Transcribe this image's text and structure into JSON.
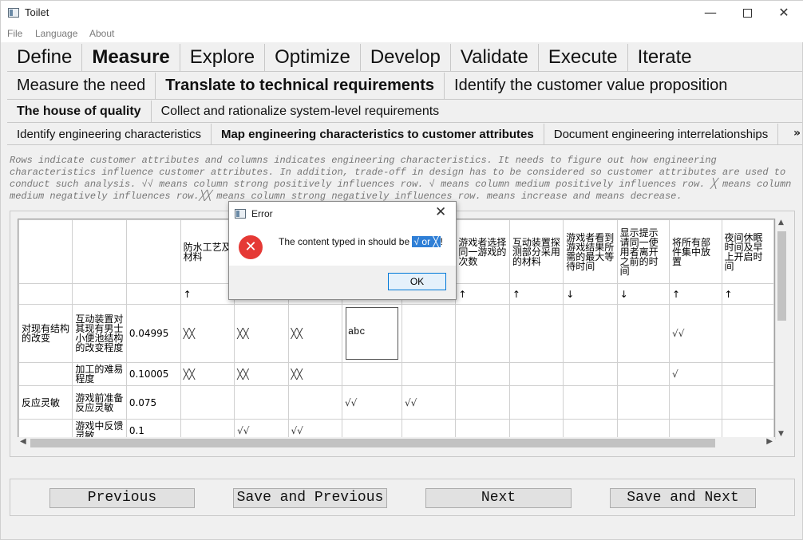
{
  "window": {
    "title": "Toilet",
    "minimize": "—",
    "close": "✕"
  },
  "menu": [
    "File",
    "Language",
    "About"
  ],
  "tabs_level1": [
    {
      "label": "Define",
      "active": false
    },
    {
      "label": "Measure",
      "active": true
    },
    {
      "label": "Explore",
      "active": false
    },
    {
      "label": "Optimize",
      "active": false
    },
    {
      "label": "Develop",
      "active": false
    },
    {
      "label": "Validate",
      "active": false
    },
    {
      "label": "Execute",
      "active": false
    },
    {
      "label": "Iterate",
      "active": false
    }
  ],
  "tabs_level2": [
    {
      "label": "Measure the need",
      "active": false
    },
    {
      "label": "Translate to technical requirements",
      "active": true
    },
    {
      "label": "Identify the customer value proposition",
      "active": false
    }
  ],
  "tabs_level3": [
    {
      "label": "The house of quality",
      "active": true
    },
    {
      "label": "Collect and rationalize system-level requirements",
      "active": false
    }
  ],
  "tabs_level4": [
    {
      "label": "Identify engineering characteristics",
      "active": false
    },
    {
      "label": "Map engineering characteristics to customer attributes",
      "active": true
    },
    {
      "label": "Document engineering interrelationships",
      "active": false
    }
  ],
  "tabs_more": "»",
  "description": "Rows indicate customer attributes and columns indicates engineering characteristics. It needs to figure out how engineering characteristics influence customer attributes. In addition, trade-off in design has to be considered so customer attributes are used to conduct such analysis. √√ means column strong positively influences row. √ means column medium positively influences row. ╳ means column medium negatively influences row.╳╳ means column strong negatively influences row. means increase and means decrease.",
  "table": {
    "headers": [
      "",
      "",
      "",
      "防水工艺及材料",
      "",
      "",
      "",
      "",
      "游戏者选择同一游戏的次数",
      "互动装置探测部分采用的材料",
      "游戏者看到游戏结果所需的最大等待时间",
      "显示提示请同一使用者离开之前的时间",
      "将所有部件集中放置",
      "夜间休眠时间及早上开启时间"
    ],
    "arrows": [
      "",
      "",
      "",
      "↑",
      "",
      "",
      "",
      "",
      "↑",
      "↑",
      "↓",
      "↓",
      "↑",
      "↑"
    ],
    "rows": [
      [
        "对现有结构的改变",
        "互动装置对其现有男士小便池结构的改变程度",
        "0.04995",
        "╳╳",
        "╳╳",
        "╳╳",
        "abc",
        "",
        "",
        "",
        "",
        "",
        "√√",
        ""
      ],
      [
        "",
        "加工的难易程度",
        "0.10005",
        "╳╳",
        "╳╳",
        "╳╳",
        "",
        "",
        "",
        "",
        "",
        "",
        "√",
        ""
      ],
      [
        "反应灵敏",
        "游戏前准备反应灵敏",
        "0.075",
        "",
        "",
        "",
        "√√",
        "√√",
        "",
        "",
        "",
        "",
        "",
        ""
      ],
      [
        "",
        "游戏中反馈灵敏",
        "0.1",
        "",
        "√√",
        "√√",
        "",
        "",
        "",
        "",
        "",
        "",
        "",
        ""
      ]
    ]
  },
  "buttons": {
    "previous": "Previous",
    "save_previous": "Save and Previous",
    "next": "Next",
    "save_next": "Save and Next"
  },
  "dialog": {
    "title": "Error",
    "message_prefix": "The content typed in should be",
    "message_highlight": "√ or ╳",
    "message_suffix": "!",
    "ok": "OK",
    "icon": "error-icon"
  }
}
